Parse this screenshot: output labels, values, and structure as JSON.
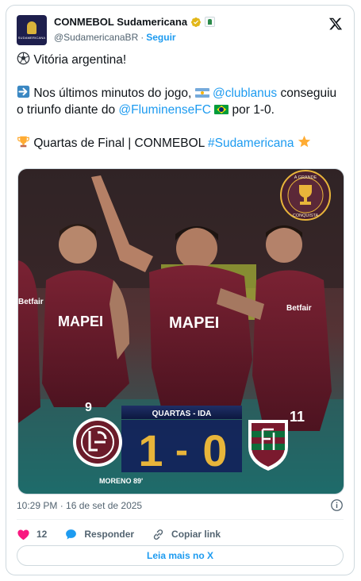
{
  "header": {
    "display_name": "CONMEBOL Sudamericana",
    "handle": "@SudamericanaBR",
    "separator": "·",
    "follow_label": "Seguir"
  },
  "tweet": {
    "line1": "Vitória argentina!",
    "line2_pre": "Nos últimos minutos do jogo,",
    "mention1": "@clublanus",
    "line2_mid": "conseguiu o triunfo diante do",
    "mention2": "@FluminenseFC",
    "line2_post": "por 1-0.",
    "line3_pre": "Quartas de Final | CONMEBOL",
    "hashtag": "#Sudamericana"
  },
  "media": {
    "badge_line1": "A GRANDE",
    "badge_line2": "CONQUISTA",
    "stage_label": "QUARTAS - IDA",
    "score_home": "1",
    "score_dash": "-",
    "score_away": "0",
    "scorer": "MORENO 89'",
    "shirt_text": "MAPEI",
    "shirt_text_right": "Betfair",
    "shirt_number": "11",
    "shirt_number_left": "9"
  },
  "footer": {
    "timestamp": "10:29 PM · 16 de set de 2025",
    "like_count": "12",
    "reply_label": "Responder",
    "copy_link_label": "Copiar link",
    "read_more_label": "Leia mais no X"
  },
  "colors": {
    "link": "#1d9bf0",
    "like": "#f91880",
    "lanus_maroon": "#6b1b2a",
    "score_gold": "#e8b53a"
  }
}
